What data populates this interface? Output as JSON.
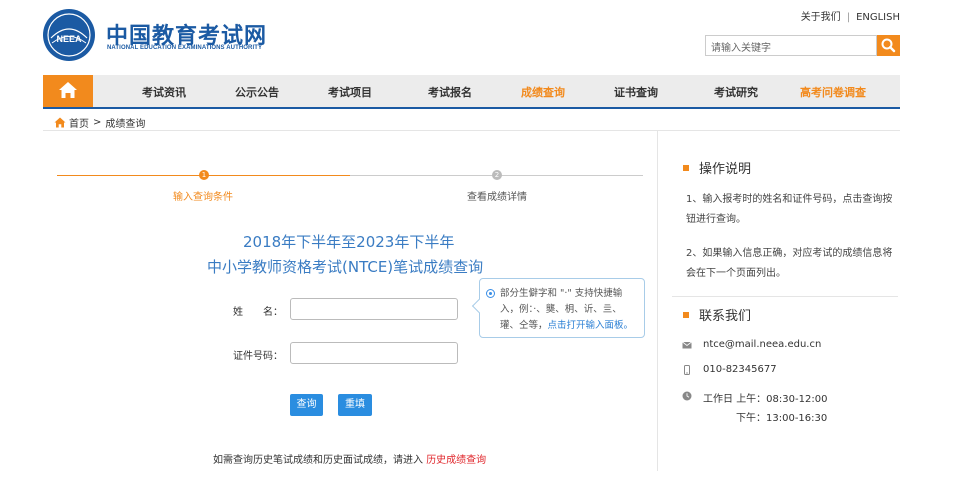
{
  "header": {
    "logo_cn": "中国教育考试网",
    "logo_en": "NATIONAL EDUCATION EXAMINATIONS AUTHORITY",
    "logo_badge": "NEEA",
    "about": "关于我们",
    "english": "ENGLISH",
    "search_placeholder": "请输入关键字",
    "accent_color": "#f28a1d",
    "brand_color": "#1b5aa3"
  },
  "nav": {
    "items": [
      {
        "label": "考试资讯"
      },
      {
        "label": "公示公告"
      },
      {
        "label": "考试项目"
      },
      {
        "label": "考试报名"
      },
      {
        "label": "成绩查询",
        "active": true
      },
      {
        "label": "证书查询"
      },
      {
        "label": "考试研究"
      },
      {
        "label": "高考问卷调查",
        "highlight": true
      }
    ]
  },
  "breadcrumb": {
    "home": "首页",
    "separator": ">",
    "current": "成绩查询"
  },
  "steps": [
    {
      "number": "1",
      "label": "输入查询条件"
    },
    {
      "number": "2",
      "label": "查看成绩详情"
    }
  ],
  "main": {
    "title_line1": "2018年下半年至2023年下半年",
    "title_line2": "中小学教师资格考试(NTCE)笔试成绩查询",
    "name_label": "姓　　名：",
    "id_label": "证件号码：",
    "name_value": "",
    "id_value": "",
    "tip_text": "部分生僻字和 \"·\" 支持快捷输入，例：·、龑、枂、䜣、亖、瓘、仝等，",
    "tip_link": "点击打开输入面板",
    "tip_end": "。",
    "query_button": "查询",
    "reset_button": "重填",
    "history_text": "如需查询历史笔试成绩和历史面试成绩，请进入",
    "history_link": "历史成绩查询"
  },
  "sidebar": {
    "ops_title": "操作说明",
    "ops_p1": "1、输入报考时的姓名和证件号码，点击查询按钮进行查询。",
    "ops_p2": "2、如果输入信息正确，对应考试的成绩信息将会在下一个页面列出。",
    "contact_title": "联系我们",
    "email": "ntce@mail.neea.edu.cn",
    "phone": "010-82345677",
    "hours_label": "工作日",
    "hours_am": "上午：08:30-12:00",
    "hours_pm": "下午：13:00-16:30"
  }
}
